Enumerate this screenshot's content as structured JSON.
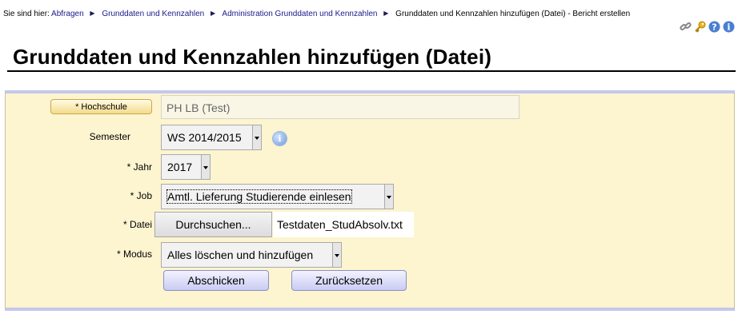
{
  "breadcrumb": {
    "prefix": "Sie sind hier:",
    "items": [
      "Abfragen",
      "Grunddaten und Kennzahlen",
      "Administration Grunddaten und Kennzahlen"
    ],
    "current": "Grunddaten und Kennzahlen hinzufügen (Datei) - Bericht erstellen"
  },
  "toolbar_icons": [
    "link-icon",
    "key-icon",
    "help-icon",
    "info-icon"
  ],
  "page_title": "Grunddaten und Kennzahlen hinzufügen (Datei)",
  "form": {
    "hochschule": {
      "label": "* Hochschule",
      "value": "PH LB (Test)"
    },
    "semester": {
      "label": "Semester",
      "value": "WS 2014/2015"
    },
    "jahr": {
      "label": "* Jahr",
      "value": "2017"
    },
    "job": {
      "label": "* Job",
      "value": "Amtl. Lieferung Studierende einlesen"
    },
    "datei": {
      "label": "* Datei",
      "button": "Durchsuchen...",
      "filename": "Testdaten_StudAbsolv.txt"
    },
    "modus": {
      "label": "* Modus",
      "value": "Alles löschen und hinzufügen"
    },
    "submit": "Abschicken",
    "reset": "Zurücksetzen"
  },
  "colors": {
    "panel_bg": "#fdf4d0",
    "button_bg": "#c9ccf2",
    "panel_border": "#c5c7ea"
  }
}
